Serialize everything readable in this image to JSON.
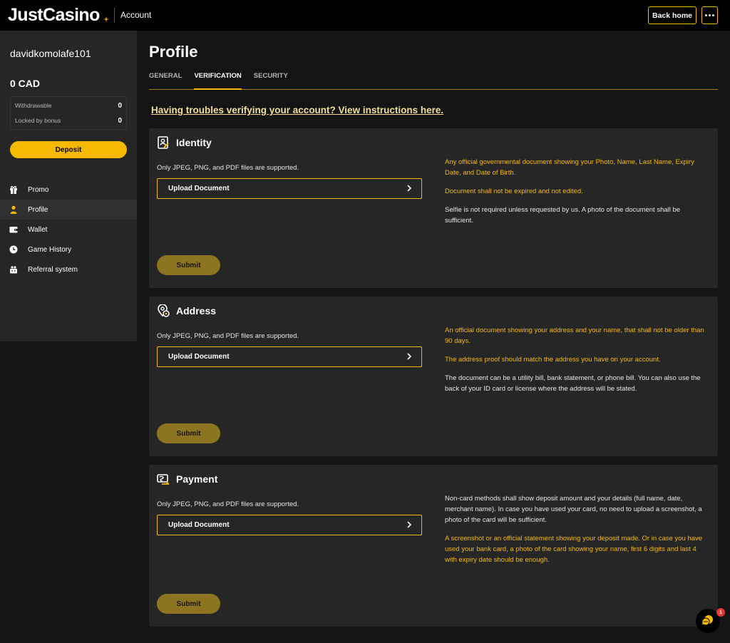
{
  "header": {
    "logo": "JustCasino",
    "section": "Account",
    "back_home": "Back home",
    "more_icon": "ellipsis-icon"
  },
  "sidebar": {
    "username": "davidkomolafe101",
    "balance": "0 CAD",
    "withdrawable_label": "Withdrawable",
    "withdrawable_value": "0",
    "locked_label": "Locked by bonus",
    "locked_value": "0",
    "deposit": "Deposit",
    "items": [
      {
        "label": "Promo",
        "icon": "gift-icon"
      },
      {
        "label": "Profile",
        "icon": "user-icon"
      },
      {
        "label": "Wallet",
        "icon": "wallet-icon"
      },
      {
        "label": "Game History",
        "icon": "clock-icon"
      },
      {
        "label": "Referral system",
        "icon": "referral-icon"
      }
    ]
  },
  "main": {
    "title": "Profile",
    "tabs": [
      "GENERAL",
      "VERIFICATION",
      "SECURITY"
    ],
    "help_link": "Having troubles verifying your account? View instructions here.",
    "cards": [
      {
        "title": "Identity",
        "icon": "id-card-icon",
        "supported": "Only JPEG, PNG, and PDF files are supported.",
        "upload": "Upload Document",
        "submit": "Submit",
        "notes": [
          "Any official governmental document showing your Photo, Name, Last Name, Expiry Date, and Date of Birth.",
          "Document shall not be expired and not edited.",
          "Selfie is not required unless requested by us. A photo of the document shall be sufficient."
        ]
      },
      {
        "title": "Address",
        "icon": "location-pin-icon",
        "supported": "Only JPEG, PNG, and PDF files are supported.",
        "upload": "Upload Document",
        "submit": "Submit",
        "notes": [
          "An official document showing your address and your name, that shall not be older than 90 days.",
          "The address proof should match the address you have on your account.",
          "The document can be a utility bill, bank statement, or phone bill. You can also use the back of your ID card or license where the address will be stated."
        ]
      },
      {
        "title": "Payment",
        "icon": "payment-card-icon",
        "supported": "Only JPEG, PNG, and PDF files are supported.",
        "upload": "Upload Document",
        "submit": "Submit",
        "notes": [
          "Non-card methods shall show deposit amount and your details (full name, date, merchant name). In case you have used your card, no need to upload a screenshot, a photo of the card will be sufficient.",
          "A screenshot or an official statement showing your deposit made. Or in case you have used your bank card, a photo of the card showing your name, first 6 digits and last 4 with expiry date should be enough."
        ]
      }
    ]
  },
  "chat": {
    "badge": "1",
    "icon": "chat-icon"
  },
  "colors": {
    "accent": "#f5b900",
    "submit_disabled": "#8c7421",
    "card_bg": "#262626",
    "page_bg": "#141414"
  }
}
